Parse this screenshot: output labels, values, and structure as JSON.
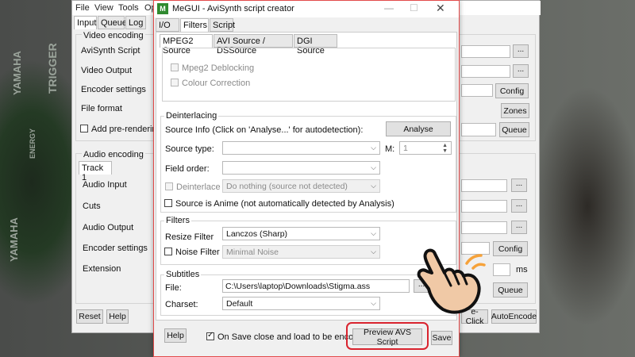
{
  "background": {
    "texts": [
      "TRIGGER",
      "YAMAHA",
      "ENERGY",
      "YAMAHA"
    ]
  },
  "megui": {
    "menu": [
      "File",
      "View",
      "Tools",
      "Op"
    ],
    "tabs": [
      "Input",
      "Queue",
      "Log"
    ],
    "video": {
      "group_label": "Video encoding",
      "rows": [
        "AviSynth Script",
        "Video Output",
        "Encoder settings",
        "File format"
      ],
      "prerender": "Add pre-rendering j"
    },
    "audio": {
      "group_label": "Audio encoding",
      "track_tab": "Track 1",
      "rows": [
        "Audio Input",
        "Cuts",
        "Audio Output",
        "Encoder settings",
        "Extension"
      ]
    },
    "right_buttons": {
      "config1": "Config",
      "zones": "Zones",
      "queue1": "Queue",
      "config2": "Config",
      "queue2": "Queue",
      "ms": "ms",
      "oneclick": "e-Click",
      "autoencode": "AutoEncode"
    },
    "bottom": {
      "reset": "Reset",
      "help": "Help"
    },
    "dots": "..."
  },
  "dialog": {
    "title": "MeGUI - AviSynth script creator",
    "tabs": [
      "I/O",
      "Filters",
      "Script"
    ],
    "subtabs": [
      "MPEG2 Source",
      "AVI Source / DSSource",
      "DGI Source"
    ],
    "mpeg2": {
      "deblocking": "Mpeg2 Deblocking",
      "colour": "Colour Correction"
    },
    "deinterlacing": {
      "label": "Deinterlacing",
      "source_info": "Source Info (Click on 'Analyse...' for autodetection):",
      "analyse": "Analyse",
      "source_type": "Source type:",
      "m_label": "M:",
      "m_value": "1",
      "field_order": "Field order:",
      "deinterlace": "Deinterlace",
      "deinterlace_value": "Do nothing (source not detected)",
      "anime": "Source is Anime (not automatically detected by Analysis)"
    },
    "filters": {
      "label": "Filters",
      "resize_label": "Resize Filter",
      "resize_value": "Lanczos (Sharp)",
      "noise_label": "Noise Filter",
      "noise_value": "Minimal Noise"
    },
    "subtitles": {
      "label": "Subtitles",
      "file_label": "File:",
      "file_value": "C:\\Users\\laptop\\Downloads\\Stigma.ass",
      "charset_label": "Charset:",
      "charset_value": "Default",
      "dots": "..."
    },
    "footer": {
      "help": "Help",
      "onsave": "On Save close and load to be encoded",
      "preview": "Preview AVS Script",
      "save": "Save"
    }
  }
}
